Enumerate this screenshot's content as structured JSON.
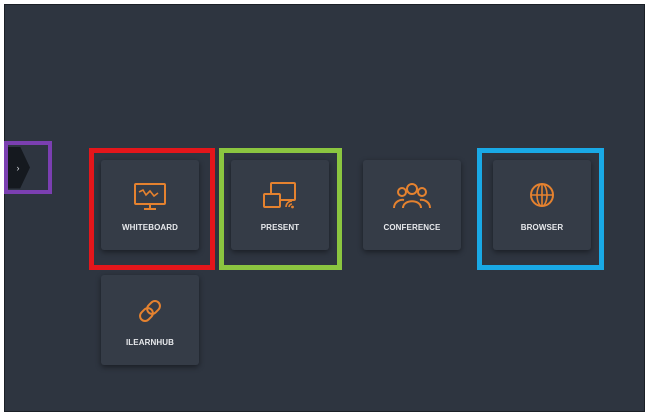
{
  "drawer": {
    "glyph": "›"
  },
  "tiles": [
    {
      "id": "whiteboard",
      "label": "WHITEBOARD",
      "icon": "whiteboard-icon"
    },
    {
      "id": "present",
      "label": "PRESENT",
      "icon": "screen-cast-icon"
    },
    {
      "id": "conference",
      "label": "CONFERENCE",
      "icon": "people-group-icon"
    },
    {
      "id": "browser",
      "label": "BROWSER",
      "icon": "globe-icon"
    },
    {
      "id": "ilearnhub",
      "label": "ILEARNHUB",
      "icon": "link-chain-icon"
    }
  ],
  "colors": {
    "background": "#2e3540",
    "tile": "#353c47",
    "icon_accent": "#e5822f",
    "label": "#e7e9ec",
    "highlight_whiteboard": "#e4161b",
    "highlight_present": "#8bc540",
    "highlight_browser": "#19a9e6",
    "highlight_drawer": "#7b3fb1"
  }
}
